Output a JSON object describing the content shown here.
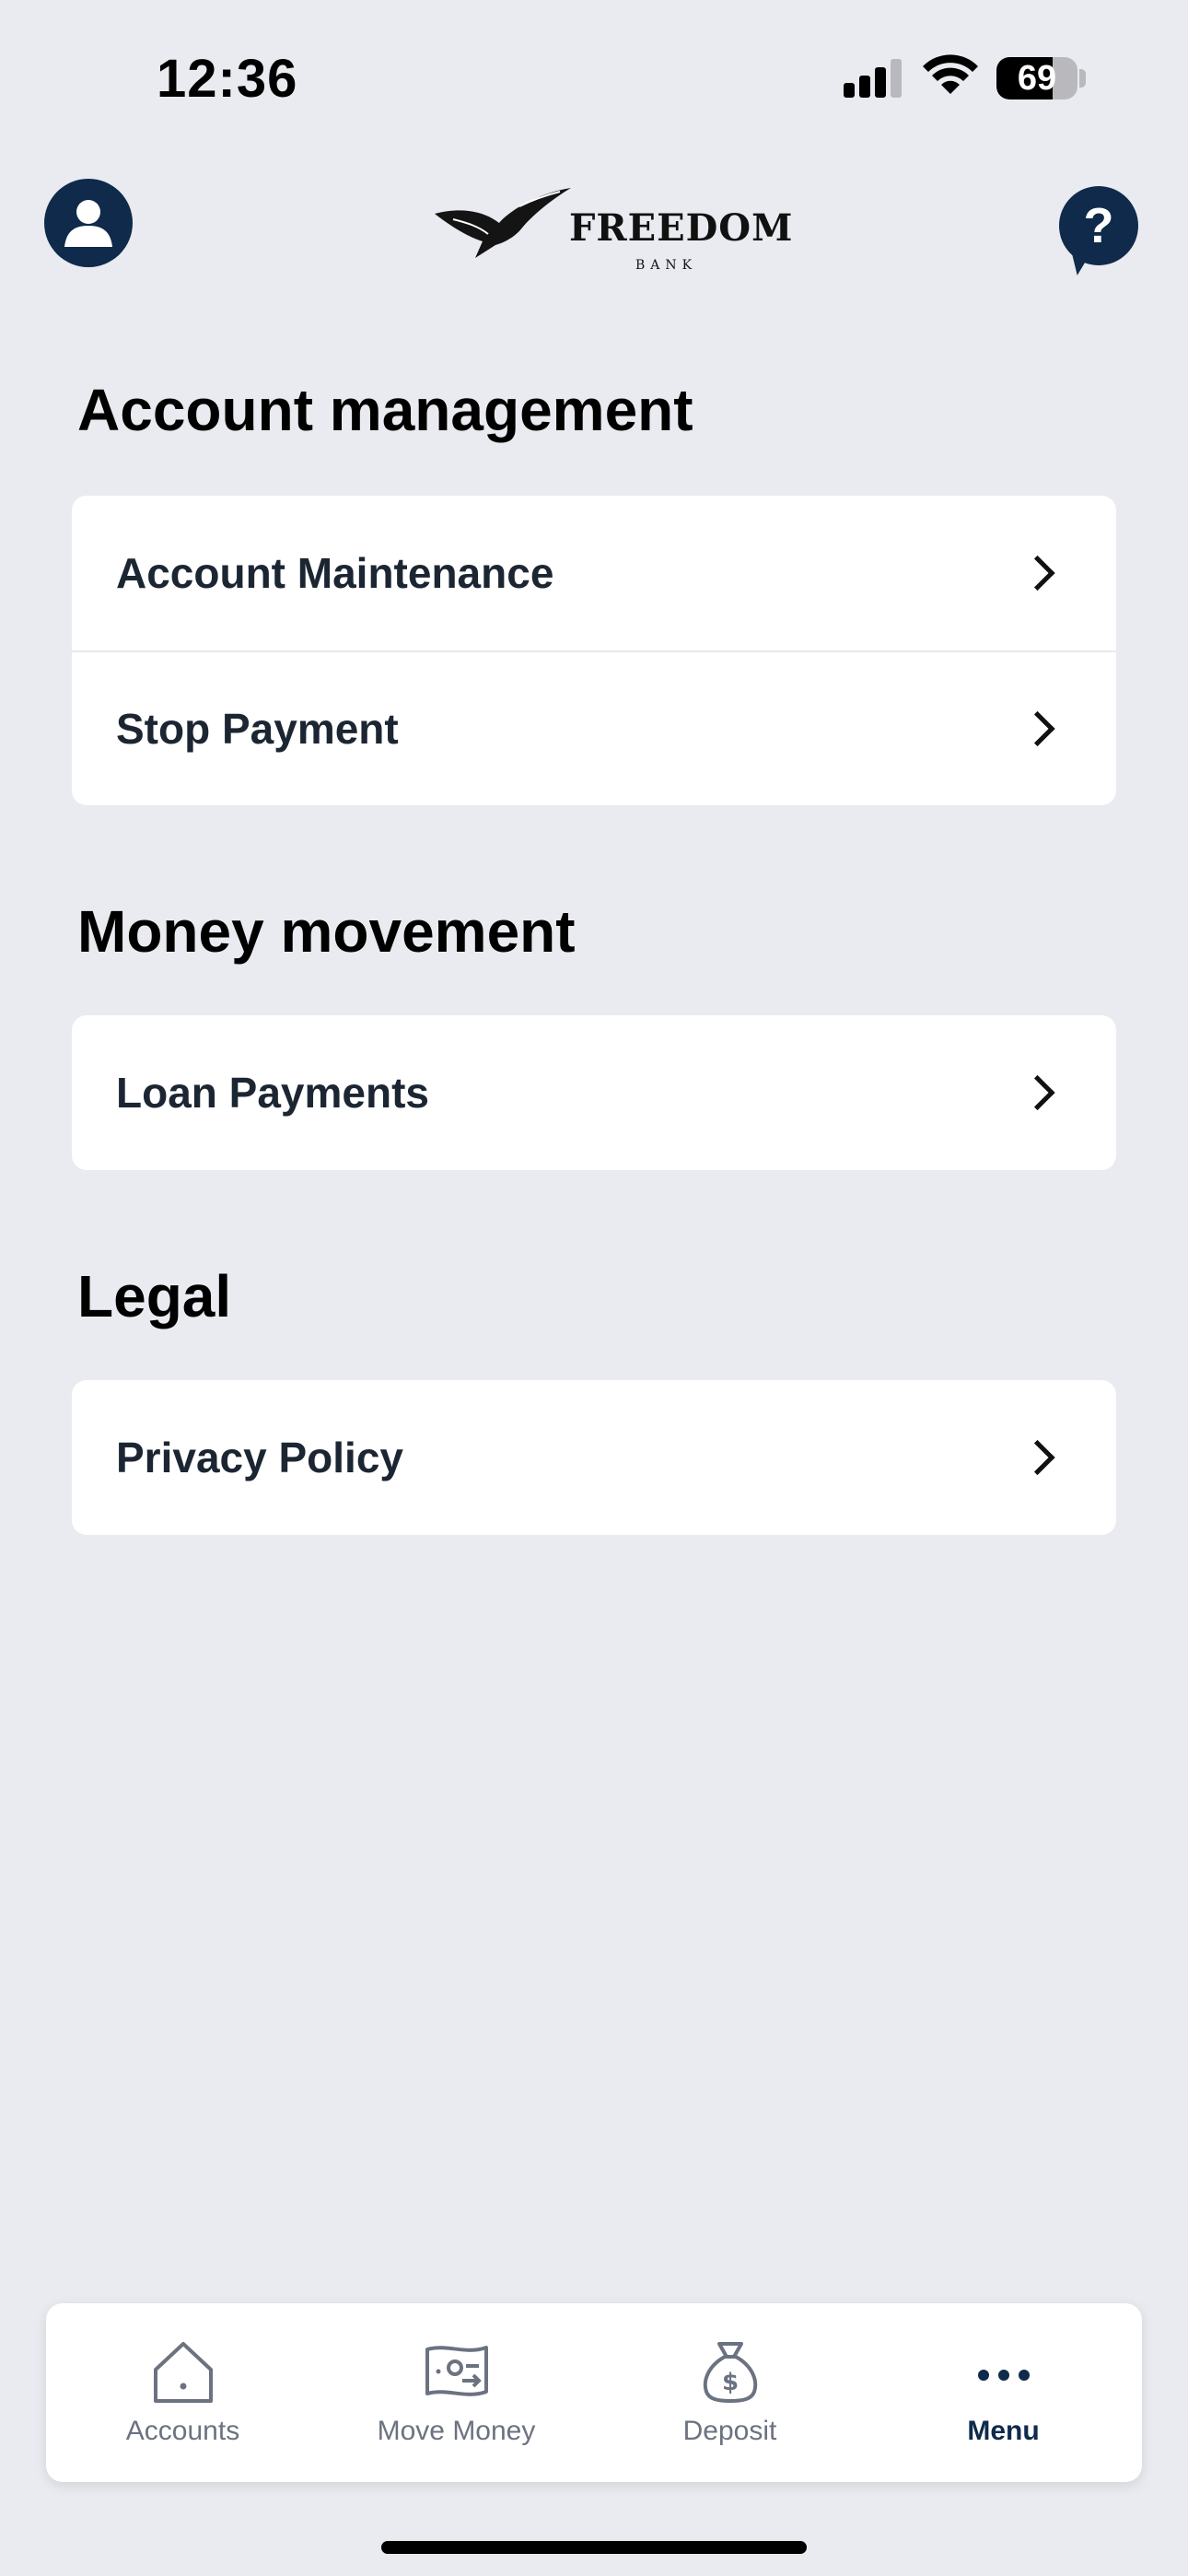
{
  "status_bar": {
    "time": "12:36",
    "battery_level": "69",
    "battery_percent": 69
  },
  "header": {
    "logo_word": "FREEDOM",
    "logo_sub": "BANK"
  },
  "sections": [
    {
      "title": "Account management",
      "items": [
        {
          "label": "Account Maintenance"
        },
        {
          "label": "Stop Payment"
        }
      ]
    },
    {
      "title": "Money movement",
      "items": [
        {
          "label": "Loan Payments"
        }
      ]
    },
    {
      "title": "Legal",
      "items": [
        {
          "label": "Privacy Policy"
        }
      ]
    }
  ],
  "tab_bar": {
    "tabs": [
      {
        "label": "Accounts",
        "icon": "house-icon"
      },
      {
        "label": "Move Money",
        "icon": "transfer-money-icon"
      },
      {
        "label": "Deposit",
        "icon": "money-bag-icon"
      },
      {
        "label": "Menu",
        "icon": "more-dots-icon",
        "active": true
      }
    ]
  },
  "colors": {
    "background": "#e9ebf0",
    "navy": "#0f2a4a",
    "card": "#ffffff",
    "tab_inactive": "#6b7280"
  }
}
